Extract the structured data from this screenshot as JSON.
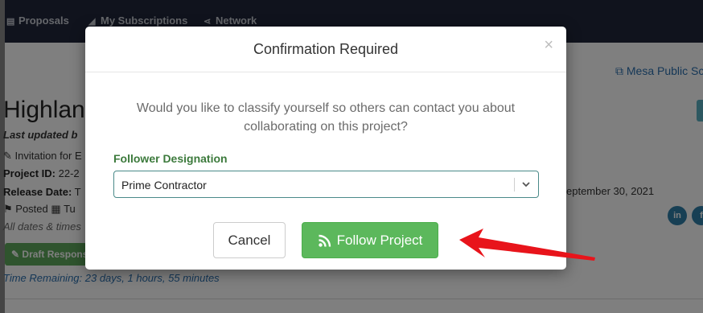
{
  "nav": {
    "items": [
      {
        "label": "Proposals",
        "icon": "document-icon"
      },
      {
        "label": "My Subscriptions",
        "icon": "rss-icon"
      },
      {
        "label": "Network",
        "icon": "share-icon"
      }
    ]
  },
  "background": {
    "external_link": "Mesa Public Sc",
    "title": "Highlan",
    "last_updated": "Last updated b",
    "invitation": "Invitation for E",
    "project_id_label": "Project ID:",
    "project_id_value": "22-2",
    "release_label": "Release Date:",
    "release_value": "T",
    "posted_label": "Posted",
    "posted_value": "Tu",
    "dates_note": "All dates & times",
    "due_date": "eptember 30, 2021",
    "draft_button": "Draft Response",
    "time_remaining": "Time Remaining: 23 days, 1 hours, 55 minutes"
  },
  "modal": {
    "title": "Confirmation Required",
    "close": "×",
    "question": "Would you like to classify yourself so others can contact you about collaborating on this project?",
    "field_label": "Follower Designation",
    "select_value": "Prime Contractor",
    "cancel_label": "Cancel",
    "follow_label": "Follow Project"
  },
  "colors": {
    "navbar": "#20263a",
    "follow_button": "#5cb85c",
    "label_green": "#3c7a3c",
    "arrow_red": "#e8141b"
  }
}
